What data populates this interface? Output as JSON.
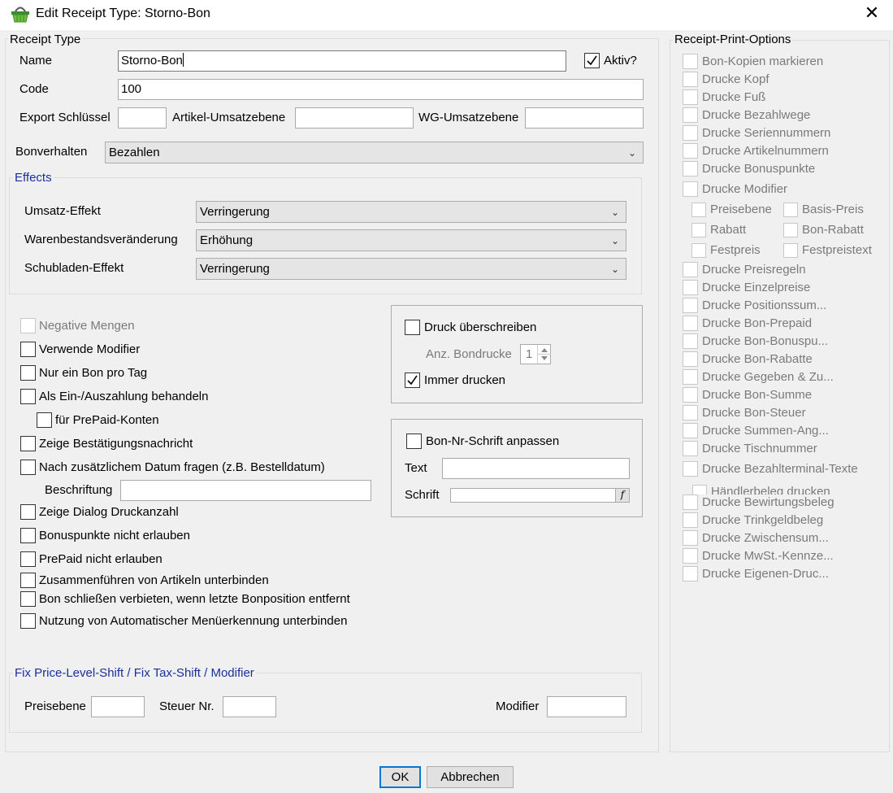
{
  "window": {
    "title": "Edit Receipt Type: Storno-Bon",
    "close": "✕"
  },
  "receipt_type": {
    "legend": "Receipt Type",
    "name_label": "Name",
    "name_value": "Storno-Bon",
    "aktiv_label": "Aktiv?",
    "aktiv_checked": true,
    "code_label": "Code",
    "code_value": "100",
    "export_label": "Export Schlüssel",
    "export_value": "",
    "artikel_label": "Artikel-Umsatzebene",
    "artikel_value": "",
    "wg_label": "WG-Umsatzebene",
    "wg_value": "",
    "bonverhalten_label": "Bonverhalten",
    "bonverhalten_value": "Bezahlen"
  },
  "effects": {
    "legend": "Effects",
    "umsatz_label": "Umsatz-Effekt",
    "umsatz_value": "Verringerung",
    "waren_label": "Warenbestandsveränderung",
    "waren_value": "Erhöhung",
    "schub_label": "Schubladen-Effekt",
    "schub_value": "Verringerung"
  },
  "options": [
    {
      "label": "Negative Mengen",
      "checked": false,
      "disabled": true
    },
    {
      "label": "Verwende Modifier",
      "checked": false
    },
    {
      "label": "Nur ein Bon pro Tag",
      "checked": false
    },
    {
      "label": "Als Ein-/Auszahlung behandeln",
      "checked": false
    },
    {
      "label": "für PrePaid-Konten",
      "checked": false
    },
    {
      "label": "Zeige Bestätigungsnachricht",
      "checked": false
    },
    {
      "label": "Nach zusätzlichem Datum fragen (z.B. Bestelldatum)",
      "checked": false
    },
    {
      "label": "Zeige Dialog Druckanzahl",
      "checked": false
    },
    {
      "label": "Bonuspunkte nicht erlauben",
      "checked": false
    },
    {
      "label": "PrePaid nicht erlauben",
      "checked": false
    },
    {
      "label": "Zusammenführen von Artikeln unterbinden",
      "checked": false
    },
    {
      "label": "Bon schließen verbieten, wenn letzte Bonposition entfernt",
      "checked": false
    },
    {
      "label": "Nutzung von Automatischer Menüerkennung unterbinden",
      "checked": false
    }
  ],
  "beschriftung": {
    "label": "Beschriftung",
    "value": ""
  },
  "druck": {
    "ueberschreiben_label": "Druck überschreiben",
    "bondrucke_label": "Anz. Bondrucke",
    "bondrucke_value": "1",
    "immer_label": "Immer drucken",
    "immer_checked": true
  },
  "bonnr": {
    "anpassen_label": "Bon-Nr-Schrift anpassen",
    "text_label": "Text",
    "text_value": "",
    "schrift_label": "Schrift",
    "schrift_btn": "f"
  },
  "fix": {
    "legend": "Fix Price-Level-Shift  / Fix Tax-Shift / Modifier",
    "preisebene_label": "Preisebene",
    "steuer_label": "Steuer Nr.",
    "modifier_label": "Modifier"
  },
  "print_options": {
    "legend": "Receipt-Print-Options",
    "items": [
      "Bon-Kopien markieren",
      "Drucke Kopf",
      "Drucke Fuß",
      "Drucke Bezahlwege",
      "Drucke Seriennummern",
      "Drucke Artikelnummern",
      "Drucke Bonuspunkte",
      "Drucke Modifier"
    ],
    "sub": [
      "Preisebene",
      "Basis-Preis",
      "Rabatt",
      "Bon-Rabatt",
      "Festpreis",
      "Festpreistext"
    ],
    "items2": [
      "Drucke Preisregeln",
      "Drucke Einzelpreise",
      "Drucke Positionssum...",
      "Drucke Bon-Prepaid",
      "Drucke Bon-Bonuspu...",
      "Drucke Bon-Rabatte",
      "Drucke Gegeben & Zu...",
      "Drucke Bon-Summe",
      "Drucke Bon-Steuer",
      "Drucke Summen-Ang...",
      "Drucke Tischnummer",
      "Drucke Bezahlterminal-Texte"
    ],
    "haendler": "Händlerbeleg drucken",
    "items3": [
      "Drucke Bewirtungsbeleg",
      "Drucke Trinkgeldbeleg",
      "Drucke Zwischensum...",
      "Drucke MwSt.-Kennze...",
      "Drucke Eigenen-Druc..."
    ]
  },
  "buttons": {
    "ok": "OK",
    "cancel": "Abbrechen"
  }
}
